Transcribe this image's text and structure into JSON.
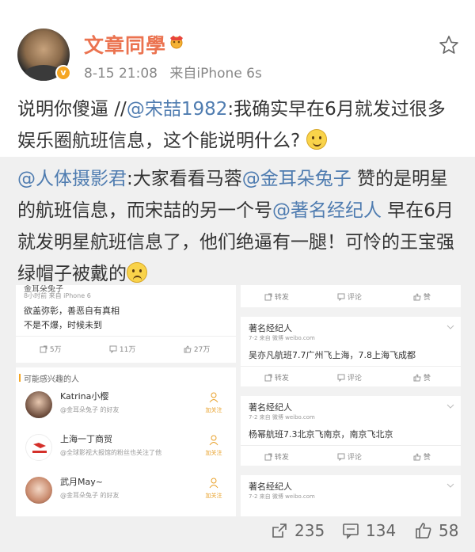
{
  "author": {
    "name": "文章同學",
    "time": "8-15 21:08",
    "source": "来自iPhone 6s",
    "verified_badge": "v"
  },
  "post": {
    "text_1": "说明你傻逼 //",
    "mention_1": "@宋喆1982",
    "text_2": ":我确实早在6月就发过很多娱乐圈航班信息，这个能说明什么?",
    "emoji": "smile-emoji"
  },
  "repost": {
    "mention_1": "@人体摄影君",
    "text_1": ":大家看看马蓉",
    "mention_2": "@金耳朵兔子",
    "text_2": " 赞的是明星的航班信息，而宋喆的另一个号",
    "mention_3": "@著名经纪人",
    "text_3": " 早在6月就发明星航班信息了，他们绝逼有一腿！可怜的王宝强绿帽子被戴的",
    "emoji": "sad-emoji"
  },
  "screenshot_left": {
    "top_name": "金耳朵兔子",
    "top_meta": "8小时前  来自 iPhone 6",
    "line1": "欲盖弥彰，善恶自有真相",
    "line2": "不是不爆，时候未到",
    "repost_count": "5万",
    "comment_count": "11万",
    "like_count": "27万",
    "suggest_title": "可能感兴趣的人",
    "users": [
      {
        "name": "Katrina小樱",
        "note": "@金耳朵兔子 的好友",
        "follow": "加关注"
      },
      {
        "name": "上海一丁商贸",
        "note": "@全球影视大报馆的粉丝也关注了他",
        "follow": "加关注"
      },
      {
        "name": "武月May~",
        "note": "@金耳朵兔子 的好友",
        "follow": "加关注"
      }
    ]
  },
  "screenshot_right": {
    "actions": {
      "repost": "转发",
      "comment": "评论",
      "like": "赞"
    },
    "posts": [
      {
        "name": "著名经纪人",
        "meta": "7-2  来自 微博 weibo.com",
        "text": "吴亦凡航班7.7广州飞上海，7.8上海飞成都"
      },
      {
        "name": "著名经纪人",
        "meta": "7-2  来自 微博 weibo.com",
        "text": "杨幂航班7.3北京飞南京，南京飞北京"
      },
      {
        "name": "著名经纪人",
        "meta": "7-2  来自 微博 weibo.com",
        "text": ""
      }
    ]
  },
  "footer": {
    "repost_count": "235",
    "comment_count": "134",
    "like_count": "58"
  },
  "colors": {
    "username": "#eb7350",
    "mention": "#4f7cb0",
    "repost_bg": "#f0f0f0"
  }
}
